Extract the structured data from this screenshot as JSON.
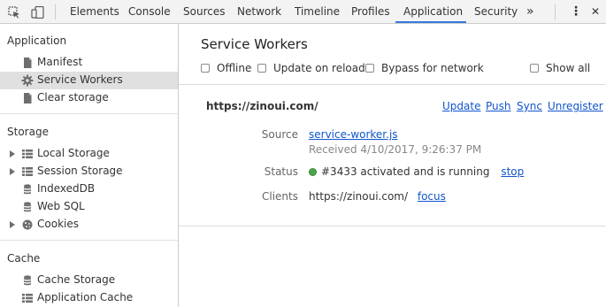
{
  "toolbar": {
    "tabs": [
      "Elements",
      "Console",
      "Sources",
      "Network",
      "Timeline",
      "Profiles",
      "Application",
      "Security"
    ],
    "active_tab": "Application",
    "more_glyph": "»",
    "menu_glyph": "⋮",
    "close_glyph": "✕"
  },
  "sidebar": {
    "application": {
      "title": "Application",
      "items": [
        "Manifest",
        "Service Workers",
        "Clear storage"
      ]
    },
    "storage": {
      "title": "Storage",
      "items": [
        "Local Storage",
        "Session Storage",
        "IndexedDB",
        "Web SQL",
        "Cookies"
      ]
    },
    "cache": {
      "title": "Cache",
      "items": [
        "Cache Storage",
        "Application Cache"
      ]
    }
  },
  "main": {
    "title": "Service Workers",
    "options": {
      "offline": "Offline",
      "update_on_reload": "Update on reload",
      "bypass": "Bypass for network",
      "show_all": "Show all"
    },
    "origin": "https://zinoui.com/",
    "actions": [
      "Update",
      "Push",
      "Sync",
      "Unregister"
    ],
    "source_label": "Source",
    "source_file": "service-worker.js",
    "received": "Received 4/10/2017, 9:26:37 PM",
    "status_label": "Status",
    "status_text": "#3433 activated and is running",
    "stop_label": "stop",
    "status_color": "#4aa54a",
    "clients_label": "Clients",
    "client_url": "https://zinoui.com/",
    "focus_label": "focus"
  },
  "colors": {
    "accent": "#3879d9",
    "link": "#1155cc",
    "selected_bg": "#e0e0e0"
  }
}
